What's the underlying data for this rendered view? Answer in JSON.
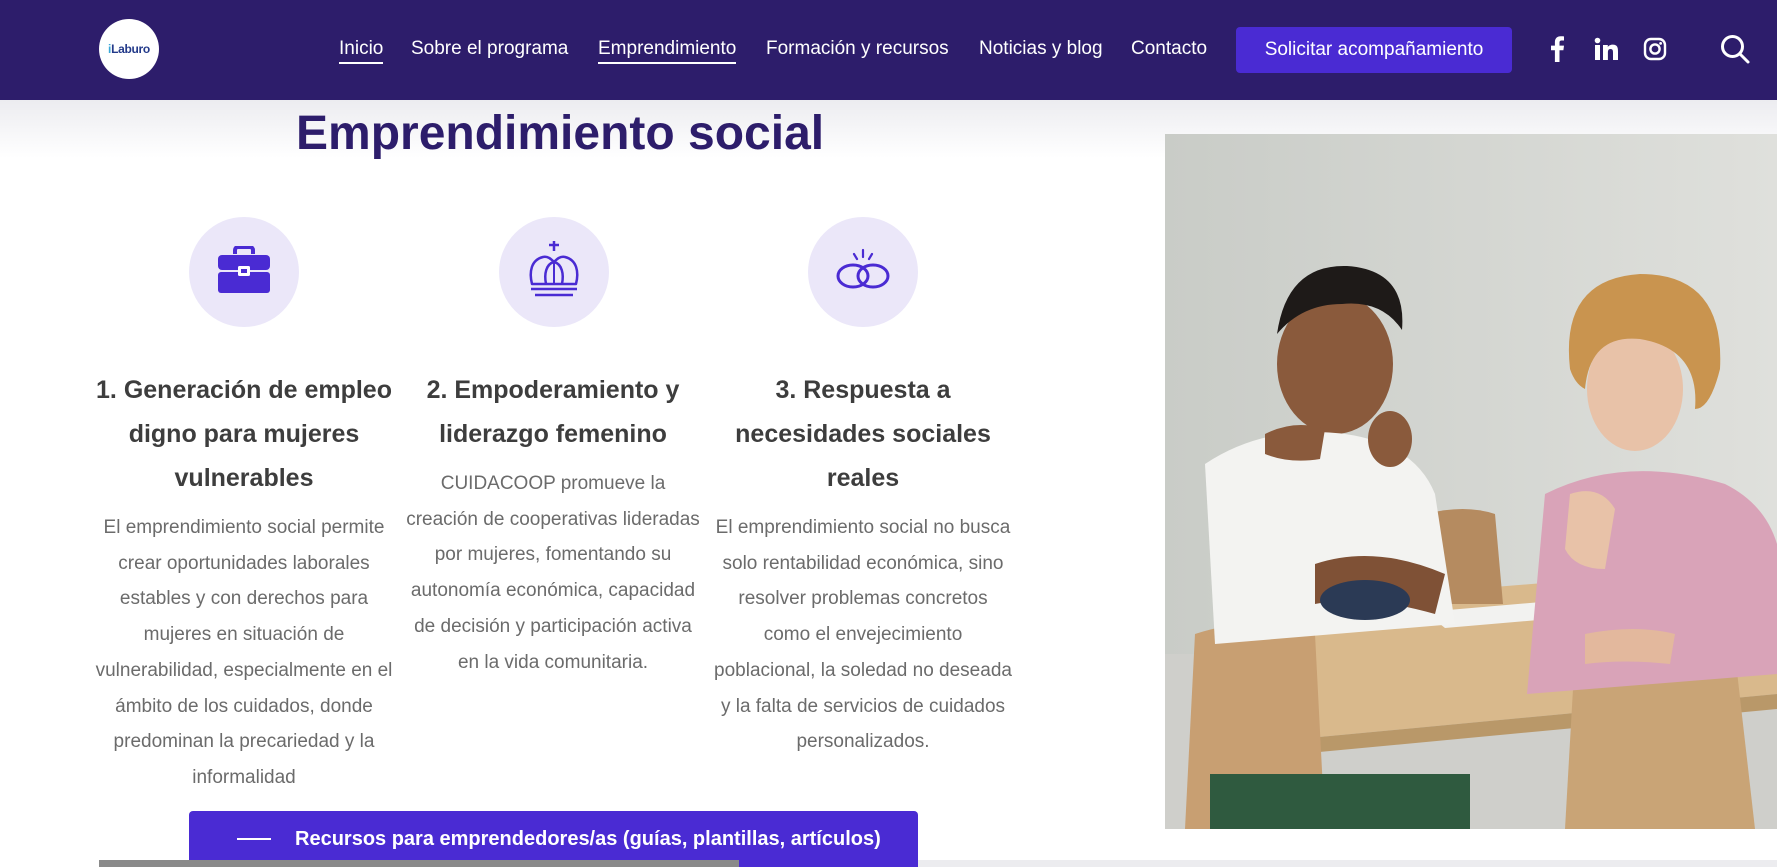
{
  "header": {
    "logo_text_prefix": "i",
    "logo_text_main": "Laburo",
    "nav": [
      {
        "label": "Inicio"
      },
      {
        "label": "Sobre el programa"
      },
      {
        "label": "Emprendimiento"
      },
      {
        "label": "Formación y recursos"
      },
      {
        "label": "Noticias y blog"
      },
      {
        "label": "Contacto"
      }
    ],
    "cta_label": "Solicitar acompañamiento",
    "social": [
      "facebook-icon",
      "linkedin-icon",
      "instagram-icon"
    ],
    "search_icon": "search-icon"
  },
  "main": {
    "title": "Emprendimiento social",
    "features": [
      {
        "icon": "briefcase-icon",
        "title": "1. Generación de empleo digno para mujeres vulnerables",
        "text": "El emprendimiento social permite crear oportunidades laborales estables y con derechos para mujeres en situación de vulnerabilidad, especialmente en el ámbito de los cuidados, donde predominan la precariedad y la informalidad"
      },
      {
        "icon": "crown-icon",
        "title": "2. Empoderamiento y liderazgo femenino",
        "text": "CUIDACOOP promueve la creación de cooperativas lideradas por mujeres, fomentando su autonomía económica, capacidad de decisión y participación activa en la vida comunitaria."
      },
      {
        "icon": "linked-rings-icon",
        "title": "3. Respuesta a necesidades sociales reales",
        "text": "El emprendimiento social no busca solo rentabilidad económica, sino resolver problemas concretos como el envejecimiento poblacional, la soledad no deseada y la falta de servicios de cuidados personalizados."
      }
    ],
    "resources_button": "Recursos para emprendedores/as (guías, plantillas, artículos)"
  },
  "colors": {
    "header_bg": "#2d1d6b",
    "accent": "#4a2bd3",
    "icon_circle": "#ebe7f9",
    "title": "#2d1d6b"
  }
}
